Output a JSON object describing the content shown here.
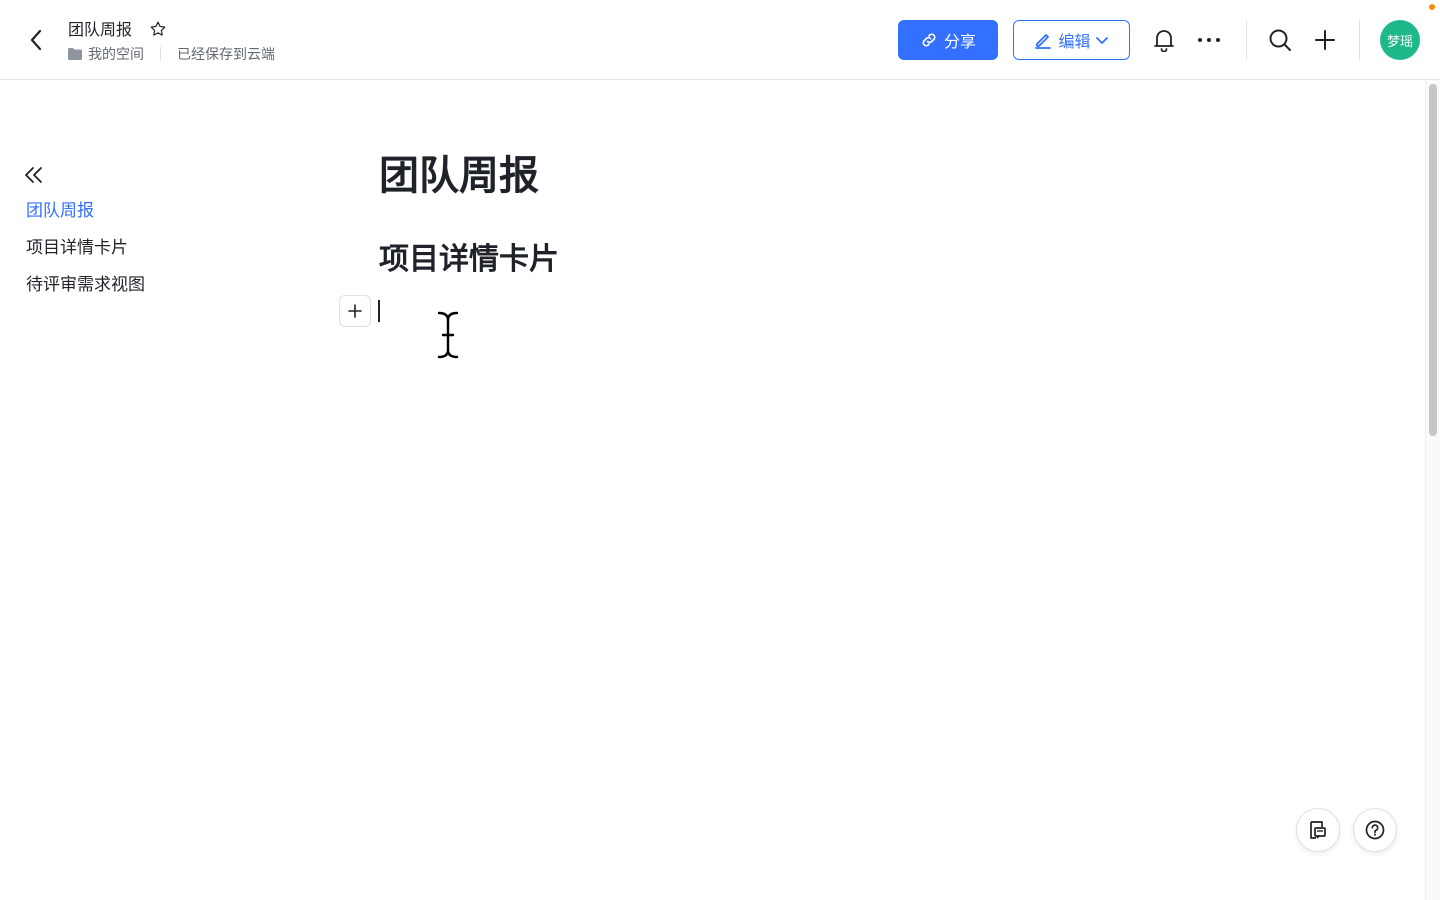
{
  "header": {
    "doc_title": "团队周报",
    "breadcrumb": "我的空间",
    "save_status": "已经保存到云端",
    "share_label": "分享",
    "edit_label": "编辑",
    "avatar_text": "梦瑶",
    "icons": [
      "back-icon",
      "star-icon",
      "folder-icon",
      "link-icon",
      "pen-icon",
      "chevron-down-icon",
      "bell-icon",
      "more-icon",
      "search-icon",
      "plus-icon"
    ]
  },
  "sidebar": {
    "items": [
      {
        "label": "团队周报",
        "active": true
      },
      {
        "label": "项目详情卡片",
        "active": false
      },
      {
        "label": "待评审需求视图",
        "active": false
      }
    ]
  },
  "document": {
    "title": "团队周报",
    "heading": "项目详情卡片"
  },
  "colors": {
    "accent": "#3370ff",
    "avatar": "#1fb88a",
    "notification": "#ff8800"
  }
}
